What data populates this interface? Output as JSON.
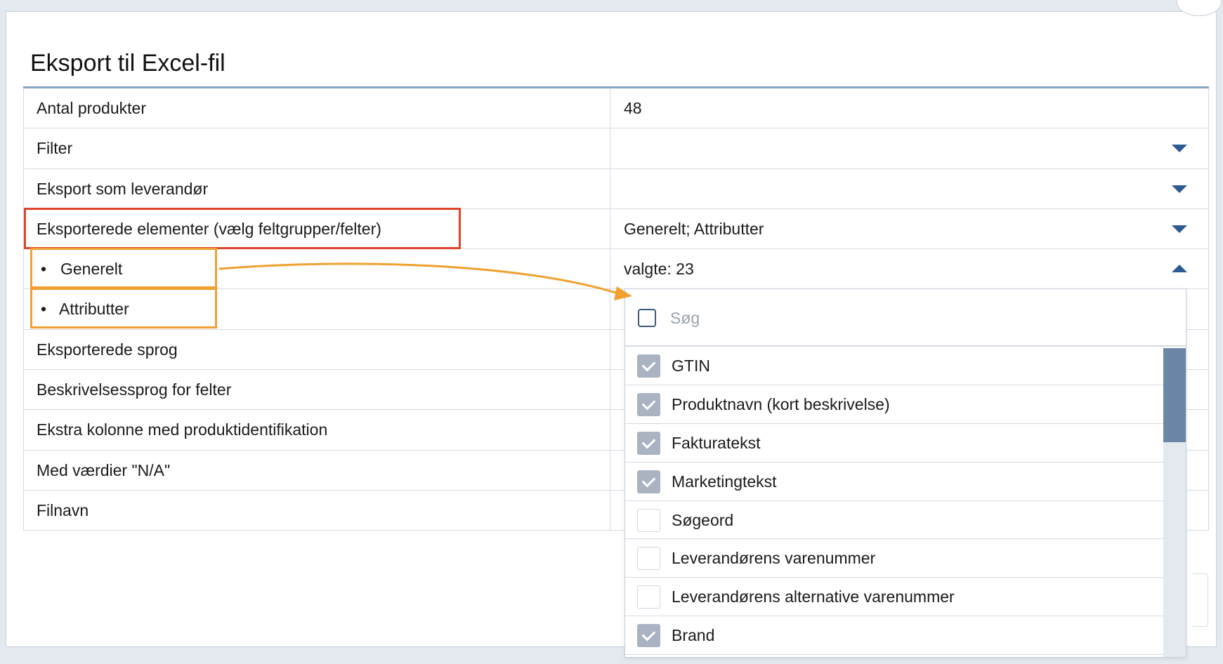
{
  "dialog": {
    "title": "Eksport til Excel-fil"
  },
  "form": {
    "rows": [
      {
        "label": "Antal produkter",
        "value": "48"
      },
      {
        "label": "Filter",
        "value": ""
      },
      {
        "label": "Eksport som leverandør",
        "value": ""
      },
      {
        "label": "Eksporterede elementer (vælg feltgrupper/felter)",
        "value": "Generelt; Attributter"
      },
      {
        "label": "Generelt",
        "value": "valgte: 23",
        "bullet": "•"
      },
      {
        "label": "Attributter",
        "value": "",
        "bullet": "•"
      },
      {
        "label": "Eksporterede sprog",
        "value": ""
      },
      {
        "label": "Beskrivelsessprog for felter",
        "value": ""
      },
      {
        "label": "Ekstra kolonne med produktidentifikation",
        "value": ""
      },
      {
        "label": "Med værdier \"N/A\"",
        "value": ""
      },
      {
        "label": "Filnavn",
        "value": ""
      }
    ]
  },
  "dropdown": {
    "search_placeholder": "Søg",
    "options": [
      {
        "label": "GTIN",
        "checked": true
      },
      {
        "label": "Produktnavn (kort beskrivelse)",
        "checked": true
      },
      {
        "label": "Fakturatekst",
        "checked": true
      },
      {
        "label": "Marketingtekst",
        "checked": true
      },
      {
        "label": "Søgeord",
        "checked": false
      },
      {
        "label": "Leverandørens varenummer",
        "checked": false
      },
      {
        "label": "Leverandørens alternative varenummer",
        "checked": false
      },
      {
        "label": "Brand",
        "checked": true
      }
    ]
  },
  "colors": {
    "highlight_red": "#e0442c",
    "highlight_orange": "#f0a030",
    "accent_blue": "#2e5a92"
  }
}
